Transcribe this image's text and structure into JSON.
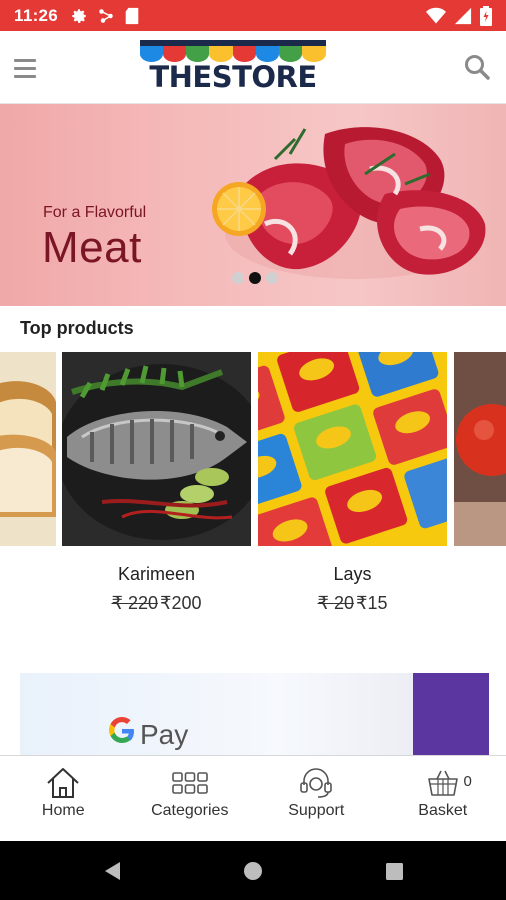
{
  "status_bar": {
    "time": "11:26"
  },
  "app_bar": {
    "logo_text": "THESTORE"
  },
  "banner": {
    "subtitle": "For a Flavorful",
    "title": "Meat",
    "active_slide": 2,
    "slide_count": 3
  },
  "top_products": {
    "title": "Top products",
    "items": [
      {
        "name": "",
        "old_price": "",
        "price": ""
      },
      {
        "name": "Karimeen",
        "old_price": "₹ 220",
        "price": "₹200"
      },
      {
        "name": "Lays",
        "old_price": "₹ 20",
        "price": "₹15"
      },
      {
        "name": "",
        "old_price": "",
        "price": ""
      }
    ]
  },
  "promo": {
    "text": "Pay"
  },
  "bottom_nav": {
    "items": [
      {
        "label": "Home",
        "icon": "home-icon"
      },
      {
        "label": "Categories",
        "icon": "grid-icon"
      },
      {
        "label": "Support",
        "icon": "headset-icon"
      },
      {
        "label": "Basket",
        "icon": "basket-icon"
      }
    ],
    "basket_count": "0"
  },
  "colors": {
    "status_bar": "#e53935",
    "banner_text": "#7a1525",
    "navy": "#1b2a4a",
    "gpay_purple": "#5b35a0"
  }
}
